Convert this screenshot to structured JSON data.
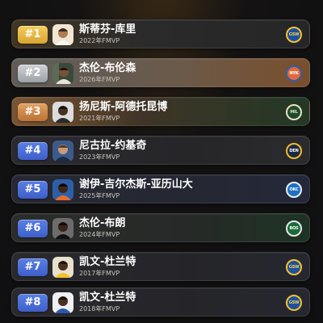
{
  "players": [
    {
      "rank": "#1",
      "name": "斯蒂芬-库里",
      "sub": "2022年FMVP",
      "team_logo": "GSW",
      "avatar": "player-photo",
      "card_bg": "linear-gradient(90deg,#3f3524 0%,#2b2a2a 45%,#262628 100%)",
      "rank_bg": "linear-gradient(180deg,#f3cf5e 0%,#d9a431 100%)",
      "logo_bg": "#1f4fa1",
      "logo_ring": "#f2c22e",
      "logo_text": "#f6d54a"
    },
    {
      "rank": "#2",
      "name": "杰伦-布伦森",
      "sub": "2026年FMVP",
      "team_logo": "NYK",
      "avatar": "player-photo",
      "card_bg": "linear-gradient(90deg,#5f5c59 0%,#6a5a4b 55%,#7a4f2c 100%)",
      "rank_bg": "linear-gradient(180deg,#cfd2d6 0%,#9da2a8 100%)",
      "logo_bg": "#e2693a",
      "logo_ring": "#2f5fb0",
      "logo_text": "#ffffff"
    },
    {
      "rank": "#3",
      "name": "扬尼斯-阿德托昆博",
      "sub": "2021年FMVP",
      "team_logo": "MIL",
      "avatar": "player-photo",
      "card_bg": "linear-gradient(90deg,#7a5532 0%,#3e3427 45%,#233826 100%)",
      "rank_bg": "linear-gradient(180deg,#e2a162 0%,#b97336 100%)",
      "logo_bg": "#1e4a2c",
      "logo_ring": "#e9dfc4",
      "logo_text": "#e9dfc4"
    },
    {
      "rank": "#4",
      "name": "尼古拉-约基奇",
      "sub": "2023年FMVP",
      "team_logo": "DEN",
      "avatar": "player-photo",
      "card_bg": "linear-gradient(90deg,#2b2a30 0%,#262629 60%,#2b2a2c 100%)",
      "rank_bg": "linear-gradient(180deg,#5a7fe6 0%,#3d5fc9 100%)",
      "logo_bg": "#1c2a42",
      "logo_ring": "#f0b92e",
      "logo_text": "#ffffff"
    },
    {
      "rank": "#5",
      "name": "谢伊-吉尔杰斯-亚历山大",
      "sub": "2025年FMVP",
      "team_logo": "OKC",
      "avatar": "player-photo",
      "card_bg": "linear-gradient(90deg,#262833 0%,#252732 60%,#24293a 100%)",
      "rank_bg": "linear-gradient(180deg,#5a7fe6 0%,#3d5fc9 100%)",
      "logo_bg": "#1f6fc2",
      "logo_ring": "#e8eef6",
      "logo_text": "#ffffff"
    },
    {
      "rank": "#6",
      "name": "杰伦-布朗",
      "sub": "2024年FMVP",
      "team_logo": "BOS",
      "avatar": "player-photo",
      "card_bg": "linear-gradient(90deg,#2b2d2b 0%,#262927 60%,#1e3324 100%)",
      "rank_bg": "linear-gradient(180deg,#5a7fe6 0%,#3d5fc9 100%)",
      "logo_bg": "#1a6b3a",
      "logo_ring": "#e6e6e6",
      "logo_text": "#ffffff"
    },
    {
      "rank": "#7",
      "name": "凯文-杜兰特",
      "sub": "2017年FMVP",
      "team_logo": "GSW",
      "avatar": "player-photo",
      "card_bg": "linear-gradient(90deg,#2a2a2e 0%,#252529 60%,#262830 100%)",
      "rank_bg": "linear-gradient(180deg,#5a7fe6 0%,#3d5fc9 100%)",
      "logo_bg": "#1f4fa1",
      "logo_ring": "#f2c22e",
      "logo_text": "#f6d54a"
    },
    {
      "rank": "#8",
      "name": "凯文-杜兰特",
      "sub": "2018年FMVP",
      "team_logo": "GSW",
      "avatar": "player-photo",
      "card_bg": "linear-gradient(90deg,#2a2a2e 0%,#252529 60%,#262830 100%)",
      "rank_bg": "linear-gradient(180deg,#5a7fe6 0%,#3d5fc9 100%)",
      "logo_bg": "#1f4fa1",
      "logo_ring": "#f2c22e",
      "logo_text": "#f6d54a"
    }
  ]
}
